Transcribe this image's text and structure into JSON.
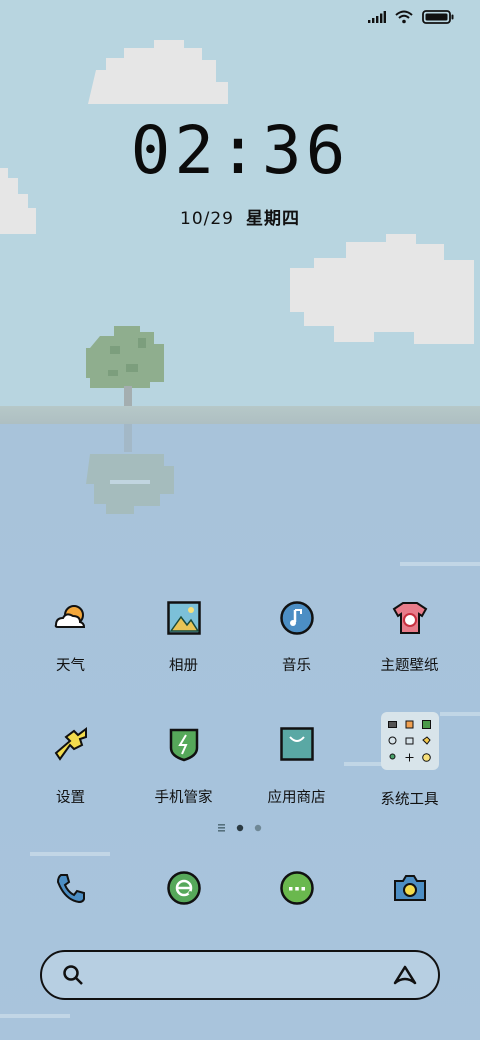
{
  "clock": {
    "time": "02:36",
    "date": "10/29",
    "weekday": "星期四"
  },
  "status_bar": {
    "signal_icon": "signal-icon",
    "wifi_icon": "wifi-icon",
    "battery_icon": "battery-icon"
  },
  "apps_row1": [
    {
      "label": "天气",
      "icon": "weather-icon"
    },
    {
      "label": "相册",
      "icon": "gallery-icon"
    },
    {
      "label": "音乐",
      "icon": "music-icon"
    },
    {
      "label": "主题壁纸",
      "icon": "theme-icon"
    }
  ],
  "apps_row2": [
    {
      "label": "设置",
      "icon": "settings-icon"
    },
    {
      "label": "手机管家",
      "icon": "security-icon"
    },
    {
      "label": "应用商店",
      "icon": "app-store-icon"
    },
    {
      "label": "系统工具",
      "icon": "folder-icon"
    }
  ],
  "page_indicator": {
    "pages": 2,
    "current": 1
  },
  "dock": [
    {
      "icon": "phone-icon"
    },
    {
      "icon": "browser-icon"
    },
    {
      "icon": "messages-icon"
    },
    {
      "icon": "camera-icon"
    }
  ],
  "search": {
    "placeholder": "",
    "search_icon": "search-icon",
    "assistant_icon": "assistant-icon"
  },
  "colors": {
    "sky": "#b8d5e0",
    "water": "#a8c3da",
    "cloud": "#e6e6e6"
  }
}
